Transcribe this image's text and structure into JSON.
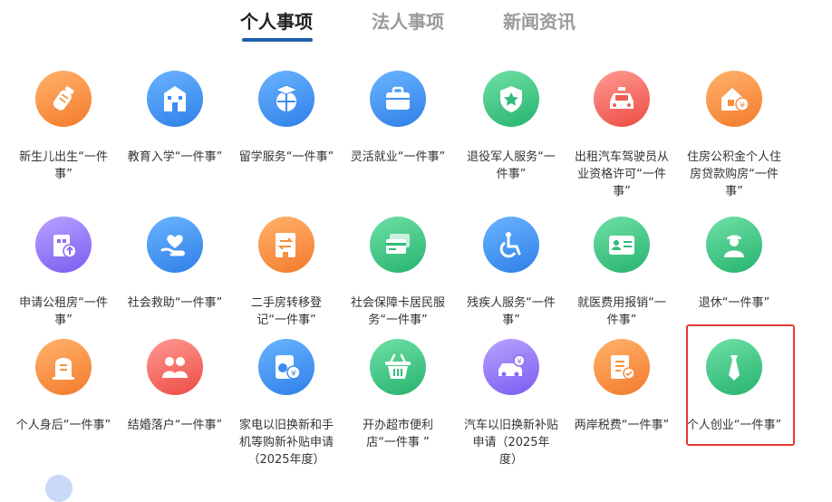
{
  "tabs": [
    {
      "label": "个人事项",
      "active": true
    },
    {
      "label": "法人事项",
      "active": false
    },
    {
      "label": "新闻资讯",
      "active": false
    }
  ],
  "items": [
    {
      "name": "item-newborn",
      "icon": "baby-bottle-icon",
      "color": "orange",
      "lines": [
        "新生儿出生“一件",
        "事”"
      ]
    },
    {
      "name": "item-education",
      "icon": "school-icon",
      "color": "blue",
      "lines": [
        "教育入学“一件事”"
      ]
    },
    {
      "name": "item-study-abroad",
      "icon": "graduation-globe-icon",
      "color": "blue",
      "lines": [
        "留学服务“一件事”"
      ]
    },
    {
      "name": "item-flexible-employment",
      "icon": "briefcase-icon",
      "color": "blue",
      "lines": [
        "灵活就业“一件事”"
      ]
    },
    {
      "name": "item-veteran",
      "icon": "star-shield-icon",
      "color": "green",
      "lines": [
        "退役军人服务“一",
        "件事”"
      ]
    },
    {
      "name": "item-taxi-driver",
      "icon": "taxi-icon",
      "color": "red",
      "lines": [
        "出租汽车驾驶员从",
        "业资格许可“一件",
        "事”"
      ]
    },
    {
      "name": "item-housing-fund",
      "icon": "house-coin-icon",
      "color": "orange",
      "lines": [
        "住房公积金个人住",
        "房贷款购房“一件",
        "事”"
      ]
    },
    {
      "name": "item-public-rental",
      "icon": "building-arrow-icon",
      "color": "purple",
      "lines": [
        "申请公租房“一件",
        "事”"
      ]
    },
    {
      "name": "item-social-relief",
      "icon": "heart-hand-icon",
      "color": "blue",
      "lines": [
        "社会救助“一件事”"
      ]
    },
    {
      "name": "item-second-hand-house",
      "icon": "building-transfer-icon",
      "color": "orange",
      "lines": [
        "二手房转移登",
        "记“一件事”"
      ]
    },
    {
      "name": "item-social-security-card",
      "icon": "cards-icon",
      "color": "green",
      "lines": [
        "社会保障卡居民服",
        "务“一件事”"
      ]
    },
    {
      "name": "item-disabled",
      "icon": "wheelchair-icon",
      "color": "blue",
      "lines": [
        "残疾人服务“一件",
        "事”"
      ]
    },
    {
      "name": "item-medical-reimbursement",
      "icon": "id-card-icon",
      "color": "green",
      "lines": [
        "就医费用报销“一",
        "件事”"
      ]
    },
    {
      "name": "item-retirement",
      "icon": "elder-person-icon",
      "color": "green",
      "lines": [
        "退休“一件事”"
      ]
    },
    {
      "name": "item-funeral",
      "icon": "tombstone-icon",
      "color": "orange",
      "lines": [
        "个人身后“一件事”"
      ]
    },
    {
      "name": "item-marriage",
      "icon": "couple-icon",
      "color": "red",
      "lines": [
        "结婚落户“一件事”"
      ]
    },
    {
      "name": "item-appliance-tradein",
      "icon": "appliance-coin-icon",
      "color": "blue",
      "lines": [
        "家电以旧换新和手",
        "机等购新补贴申请",
        "（2025年度）"
      ]
    },
    {
      "name": "item-supermarket",
      "icon": "basket-icon",
      "color": "green",
      "lines": [
        "开办超市便利",
        "店“一件事 ”"
      ]
    },
    {
      "name": "item-car-tradein",
      "icon": "car-coin-icon",
      "color": "purple",
      "lines": [
        "汽车以旧换新补贴",
        "申请（2025年",
        "度）"
      ]
    },
    {
      "name": "item-cross-strait-tax",
      "icon": "tax-receipt-icon",
      "color": "orange",
      "lines": [
        "两岸税费“一件事”"
      ]
    },
    {
      "name": "item-entrepreneurship",
      "icon": "tie-icon",
      "color": "green",
      "lines": [
        "个人创业“一件事”"
      ]
    }
  ]
}
